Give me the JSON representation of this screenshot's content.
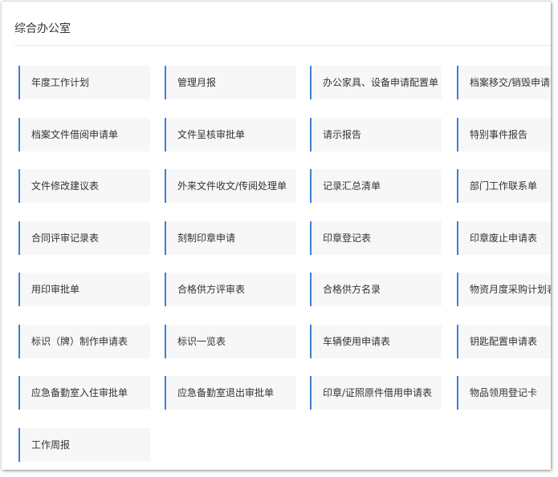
{
  "panel": {
    "title": "综合办公室",
    "accent_color": "#3f7fd6",
    "items": [
      {
        "label": "年度工作计划"
      },
      {
        "label": "管理月报"
      },
      {
        "label": "办公家具、设备申请配置单"
      },
      {
        "label": "档案移交/销毁申请"
      },
      {
        "label": "档案文件借阅申请单"
      },
      {
        "label": "文件呈核审批单"
      },
      {
        "label": "请示报告"
      },
      {
        "label": "特别事件报告"
      },
      {
        "label": "文件修改建议表"
      },
      {
        "label": "外来文件收文/传阅处理单"
      },
      {
        "label": "记录汇总清单"
      },
      {
        "label": "部门工作联系单"
      },
      {
        "label": "合同评审记录表"
      },
      {
        "label": "刻制印章申请"
      },
      {
        "label": "印章登记表"
      },
      {
        "label": "印章废止申请表"
      },
      {
        "label": "用印审批单"
      },
      {
        "label": "合格供方评审表"
      },
      {
        "label": "合格供方名录"
      },
      {
        "label": "物资月度采购计划表"
      },
      {
        "label": "标识（牌）制作申请表"
      },
      {
        "label": "标识一览表"
      },
      {
        "label": "车辆使用申请表"
      },
      {
        "label": "钥匙配置申请表"
      },
      {
        "label": "应急备勤室入住审批单"
      },
      {
        "label": "应急备勤室退出审批单"
      },
      {
        "label": "印章/证照原件借用申请表"
      },
      {
        "label": "物品领用登记卡"
      },
      {
        "label": "工作周报"
      }
    ]
  }
}
